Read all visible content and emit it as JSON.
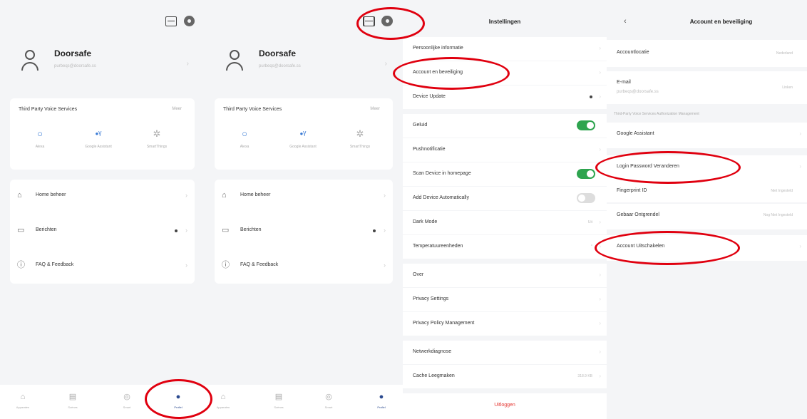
{
  "profile": {
    "name": "Doorsafe",
    "email": "purbeqs@doorsafe.ss"
  },
  "voice_services": {
    "title": "Third Party Voice Services",
    "more": "Meer",
    "items": [
      {
        "icon": "alexa-icon",
        "label": "Alexa"
      },
      {
        "icon": "google-assistant-icon",
        "label": "Google Assistant"
      },
      {
        "icon": "smartthings-icon",
        "label": "SmartThings"
      }
    ]
  },
  "menu": {
    "home": "Home beheer",
    "messages": "Berichten",
    "faq": "FAQ & Feedback"
  },
  "tabs": [
    {
      "label": "Apparaten",
      "glyph": "⌂"
    },
    {
      "label": "Scènes",
      "glyph": "▤"
    },
    {
      "label": "Smart",
      "glyph": "◎"
    },
    {
      "label": "Profiel",
      "glyph": "●"
    }
  ],
  "settings": {
    "title": "Instellingen",
    "rows": [
      {
        "label": "Persoonlijke informatie"
      },
      {
        "label": "Account en beveiliging"
      },
      {
        "label": "Device Update"
      },
      {
        "label": "Geluid",
        "toggle": "on"
      },
      {
        "label": "Pushnotificatie"
      },
      {
        "label": "Scan Device in homepage",
        "toggle": "on"
      },
      {
        "label": "Add Device Automatically",
        "toggle": "off"
      },
      {
        "label": "Dark Mode",
        "value": "Uit"
      },
      {
        "label": "Temperatuureenheden",
        "value": "°"
      },
      {
        "label": "Over"
      },
      {
        "label": "Privacy Settings"
      },
      {
        "label": "Privacy Policy Management"
      },
      {
        "label": "Netwerkdiagnose"
      },
      {
        "label": "Cache Leegmaken",
        "value": "318.9 KB"
      }
    ],
    "logout": "Uitloggen"
  },
  "account": {
    "title": "Account en beveiliging",
    "location_label": "Accountlocatie",
    "location_value": "Nederland",
    "email_label": "E-mail",
    "email_value": "purbeqs@doorsafe.ss",
    "email_status": "Linken",
    "voice_section": "Third-Party Voice Services Authorization Management",
    "google": "Google Assistant",
    "login_password": "Login Password Veranderen",
    "fingerprint": "Fingerprint ID",
    "fingerprint_value": "Niet Ingesteld",
    "gesture": "Gebaar Ontgrendel",
    "gesture_value": "Nog Niet Ingesteld",
    "delete_account": "Account Uitschakelen"
  }
}
